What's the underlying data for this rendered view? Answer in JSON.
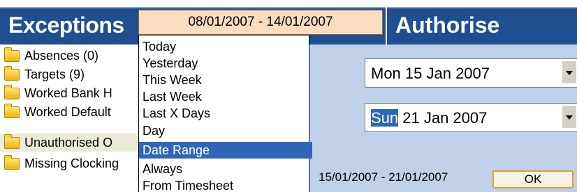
{
  "exceptions": {
    "title": "Exceptions",
    "date_range_value": "08/01/2007 - 14/01/2007",
    "items": [
      {
        "label": "Absences (0)"
      },
      {
        "label": "Targets (9)"
      },
      {
        "label": "Worked Bank H"
      },
      {
        "label": "Worked Default"
      },
      {
        "label": "Unauthorised O"
      },
      {
        "label": "Missing Clocking"
      }
    ]
  },
  "range_options": [
    {
      "label": "Today"
    },
    {
      "label": "Yesterday"
    },
    {
      "label": "This Week"
    },
    {
      "label": "Last Week"
    },
    {
      "label": "Last X Days"
    },
    {
      "label": "Day"
    },
    {
      "label": "Date Range"
    },
    {
      "label": "Always"
    },
    {
      "label": "From Timesheet"
    }
  ],
  "authorise": {
    "title": "Authorise",
    "from_date": "Mon 15 Jan 2007",
    "to_date_day": "Sun",
    "to_date_rest": " 21 Jan 2007",
    "range_text": "15/01/2007 - 21/01/2007",
    "ok_label": "OK"
  },
  "colors": {
    "header_blue": "#1f4f91",
    "selection_blue": "#2f66b8",
    "range_field": "#fbdcbf",
    "authorise_panel": "#bfd0e8"
  }
}
